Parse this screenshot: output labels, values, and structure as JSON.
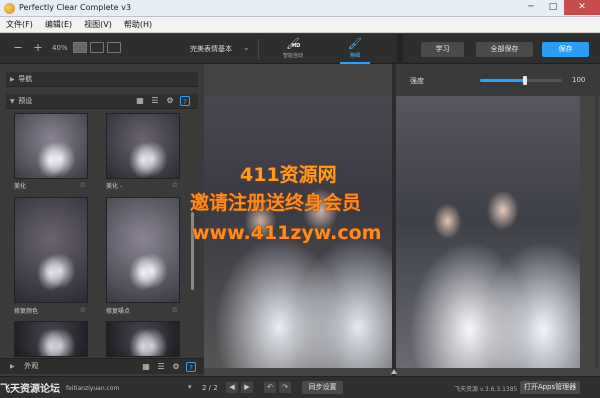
{
  "window": {
    "title": "Perfectly Clear Complete v3",
    "minimize": "─",
    "maximize": "□",
    "close": "✕"
  },
  "menu": [
    "文件(F)",
    "编辑(E)",
    "视图(V)",
    "帮助(H)"
  ],
  "toolbar": {
    "zoom_out": "−",
    "zoom_in": "+",
    "zoom": "40%",
    "preset_name": "完美表情基本",
    "preset_chevron": "⌄",
    "mode_hd_icon": "🖌",
    "mode_hd_badge": "HD",
    "mode_hd_label": "智能自动",
    "mode_fine_icon": "🖌",
    "mode_fine_label": "精细",
    "learn": "学习",
    "save_all": "全部保存",
    "save": "保存"
  },
  "left_panel": {
    "nav_label": "导航",
    "preset_label": "预设",
    "help": "?",
    "grid_icon": "▦",
    "list_icon": "☰",
    "settings_icon": "⚙",
    "thumbnails": [
      {
        "label": "美化",
        "star": "☆"
      },
      {
        "label": "美化 -",
        "star": "☆"
      },
      {
        "label": "修复颜色",
        "star": "☆"
      },
      {
        "label": "修复噪点",
        "star": "☆"
      },
      {
        "label": "",
        "star": ""
      },
      {
        "label": "",
        "star": ""
      }
    ],
    "ext_label": "外观"
  },
  "canvas": {
    "slider_label": "强度",
    "slider_value": "100",
    "slider_level": 0.55
  },
  "watermark": {
    "line1": "411资源网",
    "line2": "邀请注册送终身会员",
    "line3": "www.411zyw.com"
  },
  "status": {
    "logo": "飞天资源论坛",
    "url": "feitianziyuan.com",
    "page": "2 / 2",
    "reset": "同步设置",
    "version": "飞天资源 v.3.6.3.1385",
    "apps": "打开Apps管理器"
  },
  "colors": {
    "accent": "#2aa2ff",
    "watermark": "#ff8a1f"
  }
}
